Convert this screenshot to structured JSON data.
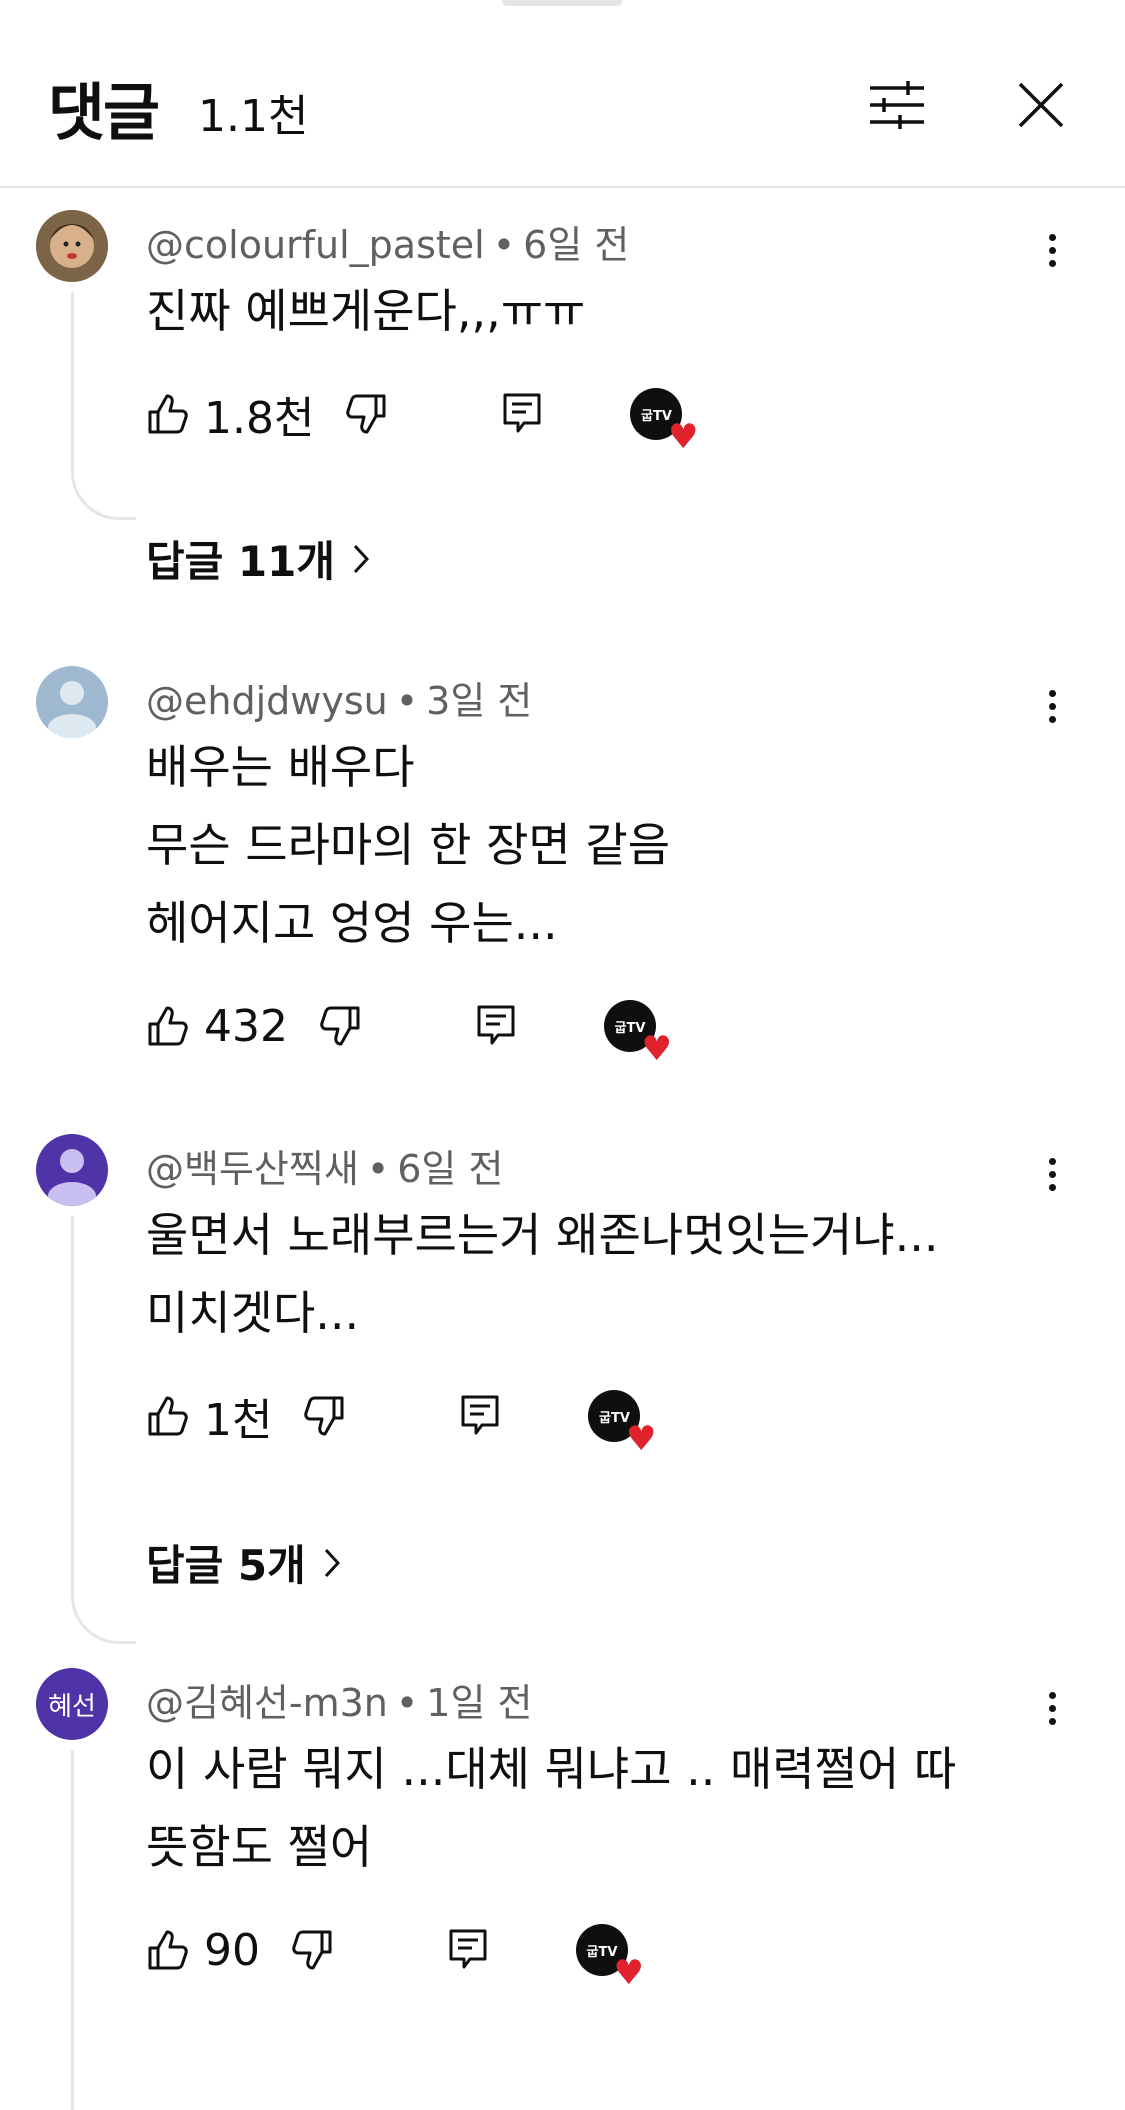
{
  "header": {
    "title": "댓글",
    "count": "1.1천"
  },
  "comments": [
    {
      "author": "@colourful_pastel",
      "time": "6일 전",
      "text": "진짜 예쁘게운다,,,ㅠㅠ",
      "likes": "1.8천",
      "replies": "답글 11개",
      "avatar_type": "photo"
    },
    {
      "author": "@ehdjdwysu",
      "time": "3일 전",
      "text": "배우는 배우다\n무슨 드라마의 한 장면 같음\n헤어지고 엉엉 우는...",
      "likes": "432",
      "avatar_type": "default",
      "avatar_color": "#9fb9d1"
    },
    {
      "author": "@백두산찍새",
      "time": "6일 전",
      "text": "울면서 노래부르는거 왜존나멋잇는거냐...\n미치겟다...",
      "likes": "1천",
      "replies": "답글 5개",
      "avatar_type": "default",
      "avatar_color": "#4f34a8"
    },
    {
      "author": "@김혜선-m3n",
      "time": "1일 전",
      "text": "이 사람 뭐지 ...대체 뭐냐고 .. 매력쩔어 따\n뜻함도 쩔어",
      "likes": "90",
      "avatar_type": "initials",
      "avatar_text": "혜선",
      "avatar_color": "#4f34a8"
    }
  ],
  "creator_badge": {
    "label": "굽TV",
    "heart_color": "#e0222c"
  }
}
